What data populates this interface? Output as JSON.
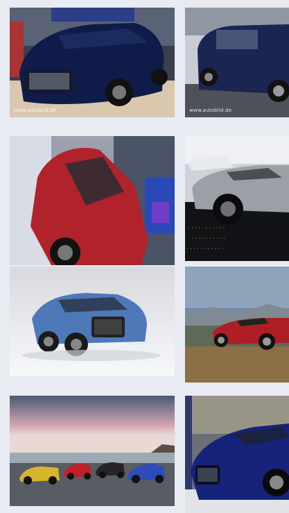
{
  "gallery": {
    "tiles": [
      {
        "watermark": "www.autobild.de"
      },
      {
        "watermark": "www.autobild.de"
      },
      {
        "watermark": ""
      },
      {
        "watermark": ""
      },
      {
        "watermark": ""
      },
      {
        "watermark": ""
      },
      {
        "watermark": ""
      },
      {
        "watermark": ""
      }
    ]
  },
  "colors": {
    "background": "#e8ebf1",
    "navy_car": "#0f1c4a",
    "red_car": "#b1232a",
    "silver_car": "#9aa0a6",
    "blue_car": "#4e79b8",
    "gold_text": "#d8c24a"
  }
}
